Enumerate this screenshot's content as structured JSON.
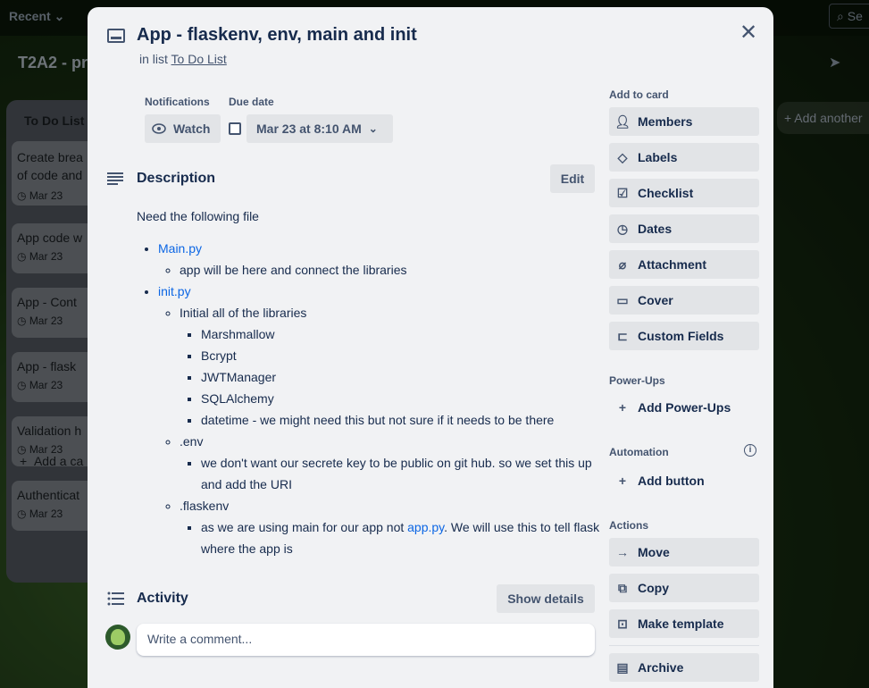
{
  "background": {
    "recent_label": "Recent",
    "search_label": "Se",
    "board_title": "T2A2 - pr",
    "list_title": "To Do List",
    "list_cards": [
      {
        "title": "Create brea\nof code and",
        "date": "Mar 23"
      },
      {
        "title": "App code w",
        "date": "Mar 23"
      },
      {
        "title": "App - Cont",
        "date": "Mar 23"
      },
      {
        "title": "App - flask",
        "date": "Mar 23"
      },
      {
        "title": "Validation h",
        "date": "Mar 23"
      },
      {
        "title": "Authenticat",
        "date": "Mar 23"
      }
    ],
    "add_card": "Add a ca",
    "add_list": "+ Add another"
  },
  "card": {
    "title": "App - flaskenv, env, main and init",
    "in_list_prefix": "in list",
    "list_name": "To Do List",
    "notifications_label": "Notifications",
    "watch_label": "Watch",
    "due_date_label": "Due date",
    "due_date_value": "Mar 23 at 8:10 AM"
  },
  "description": {
    "heading": "Description",
    "edit_label": "Edit",
    "intro": "Need the following file",
    "main_link": "Main.py",
    "main_sub": "app will be here and connect the libraries",
    "init_link": "init.py",
    "init_sub": "Initial all of the libraries",
    "libraries": [
      "Marshmallow",
      "Bcrypt",
      "JWTManager",
      "SQLAlchemy",
      "datetime - we might need this but not sure if it needs to be there"
    ],
    "env_label": ".env",
    "env_sub": "we don't want our secrete key to be public on git hub. so we set this up and add the URI",
    "flaskenv_label": ".flaskenv",
    "flaskenv_pre": "as we are using main for our app not ",
    "flaskenv_link": "app.py",
    "flaskenv_post": ". We will use this to tell flask where the app is"
  },
  "activity": {
    "heading": "Activity",
    "show_details": "Show details",
    "comment_placeholder": "Write a comment..."
  },
  "sidebar": {
    "add_to_card_heading": "Add to card",
    "add_to_card": [
      {
        "label": "Members",
        "icon": "person-icon"
      },
      {
        "label": "Labels",
        "icon": "tag-icon"
      },
      {
        "label": "Checklist",
        "icon": "checklist-icon"
      },
      {
        "label": "Dates",
        "icon": "clock-icon"
      },
      {
        "label": "Attachment",
        "icon": "paperclip-icon"
      },
      {
        "label": "Cover",
        "icon": "card-cover-icon"
      },
      {
        "label": "Custom Fields",
        "icon": "custom-fields-icon"
      }
    ],
    "powerups_heading": "Power-Ups",
    "add_powerups": "Add Power-Ups",
    "automation_heading": "Automation",
    "add_button": "Add button",
    "actions_heading": "Actions",
    "actions": [
      {
        "label": "Move",
        "icon": "arrow-right-icon"
      },
      {
        "label": "Copy",
        "icon": "copy-icon"
      },
      {
        "label": "Make template",
        "icon": "template-icon"
      },
      {
        "label": "Archive",
        "icon": "archive-icon"
      }
    ]
  }
}
